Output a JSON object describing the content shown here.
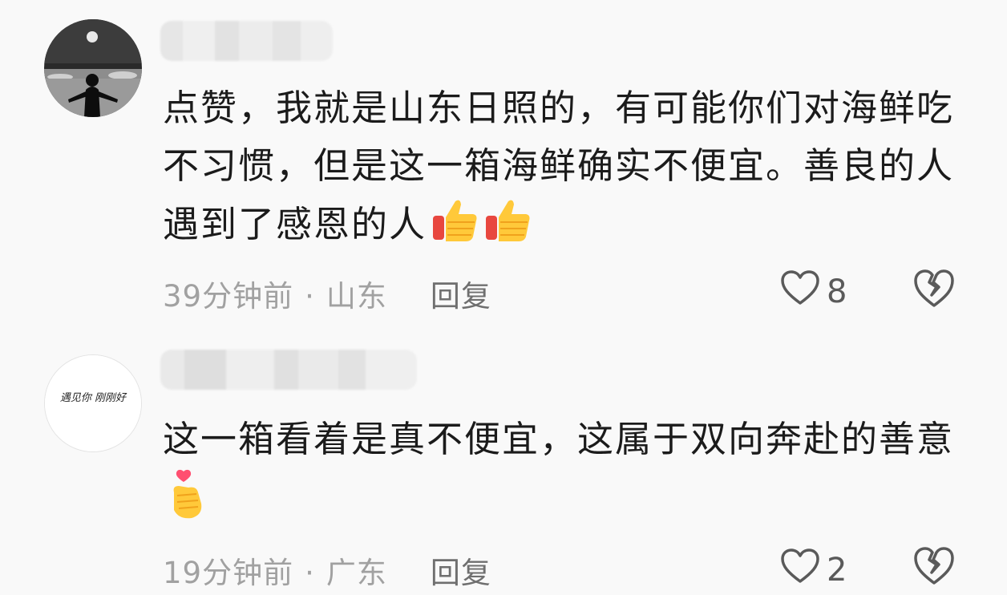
{
  "comments": [
    {
      "body": "点赞，我就是山东日照的，有可能你们对海鲜吃不习惯，但是这一箱海鲜确实不便宜。善良的人遇到了感恩的人",
      "emojis": [
        "thumbs-up",
        "thumbs-up"
      ],
      "time": "39分钟前",
      "location": "山东",
      "reply_label": "回复",
      "likes": "8"
    },
    {
      "avatar_text": "遇见你 刚刚好",
      "body": "这一箱看着是真不便宜，这属于双向奔赴的善意",
      "emojis": [
        "finger-heart"
      ],
      "time": "19分钟前",
      "location": "广东",
      "reply_label": "回复",
      "likes": "2"
    }
  ],
  "separator": "·",
  "colors": {
    "text": "#1b1b1b",
    "meta": "#a1a1a1",
    "reply": "#6f6f6f",
    "icon": "#5a5a5a",
    "background": "#f9f9f9"
  }
}
